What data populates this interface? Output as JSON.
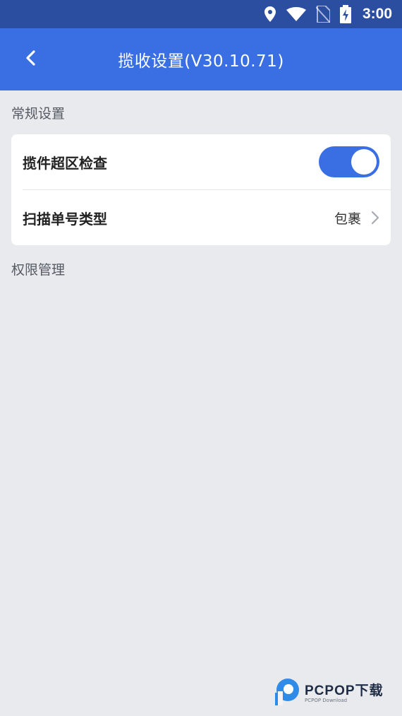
{
  "status_bar": {
    "time": "3:00",
    "icons": [
      "location-icon",
      "wifi-icon",
      "no-sim-icon",
      "battery-charging-icon"
    ]
  },
  "app_bar": {
    "title": "揽收设置(V30.10.71)",
    "back_icon": "chevron-left-icon"
  },
  "sections": {
    "general": {
      "label": "常规设置",
      "items": [
        {
          "label": "揽件超区检查",
          "control": "toggle",
          "on": true
        },
        {
          "label": "扫描单号类型",
          "value": "包裹",
          "icon": "chevron-right-icon"
        }
      ]
    },
    "permissions": {
      "label": "权限管理"
    }
  },
  "colors": {
    "status_bar": "#2b4ea1",
    "app_bar": "#3a6fe3",
    "background": "#e9eaee",
    "toggle_on": "#3a6fe3"
  },
  "watermark": {
    "main": "PCPOP下载",
    "sub": "PCPOP Download"
  }
}
